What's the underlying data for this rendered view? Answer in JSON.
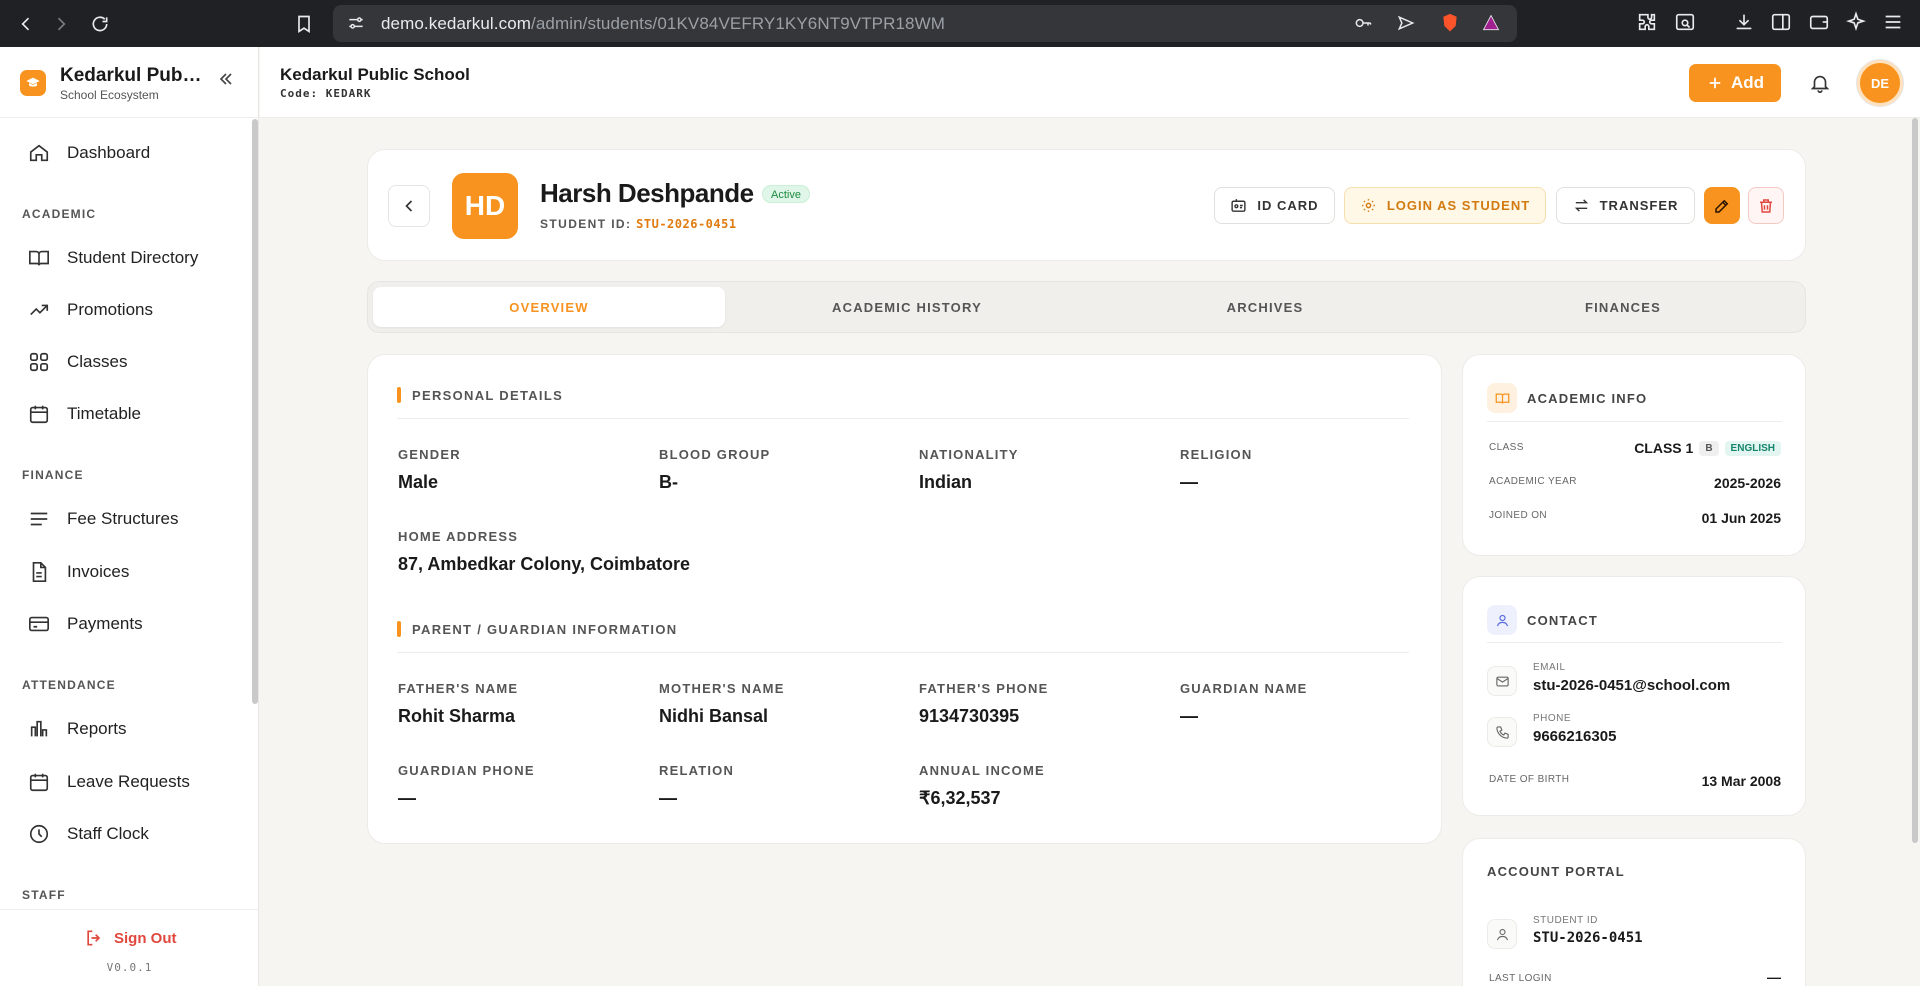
{
  "browser": {
    "url_host": "demo.kedarkul.com",
    "url_path": "/admin/students/01KV84VEFRY1KY6NT9VTPR18WM"
  },
  "sidebar": {
    "brand_name": "Kedarkul Public School",
    "brand_sub": "School Ecosystem",
    "dashboard": "Dashboard",
    "sections": {
      "academic": "ACADEMIC",
      "finance": "FINANCE",
      "attendance": "ATTENDANCE",
      "staff": "STAFF"
    },
    "items": {
      "student_directory": "Student Directory",
      "promotions": "Promotions",
      "classes": "Classes",
      "timetable": "Timetable",
      "fee_structures": "Fee Structures",
      "invoices": "Invoices",
      "payments": "Payments",
      "reports": "Reports",
      "leave_requests": "Leave Requests",
      "staff_clock": "Staff Clock"
    },
    "sign_out": "Sign Out",
    "version": "V0.0.1"
  },
  "header": {
    "school_name": "Kedarkul Public School",
    "code_label": "Code:",
    "code_value": "KEDARK",
    "add_label": "Add",
    "avatar_initials": "DE"
  },
  "profile": {
    "initials": "HD",
    "name": "Harsh Deshpande",
    "status": "Active",
    "student_id_label": "STUDENT ID:",
    "student_id": "STU-2026-0451",
    "actions": {
      "id_card": "ID CARD",
      "login_as_student": "LOGIN AS STUDENT",
      "transfer": "TRANSFER"
    }
  },
  "tabs": [
    "OVERVIEW",
    "ACADEMIC HISTORY",
    "ARCHIVES",
    "FINANCES"
  ],
  "personal": {
    "title": "PERSONAL DETAILS",
    "gender_label": "GENDER",
    "gender": "Male",
    "blood_group_label": "BLOOD GROUP",
    "blood_group": "B-",
    "nationality_label": "NATIONALITY",
    "nationality": "Indian",
    "religion_label": "RELIGION",
    "religion": "—",
    "address_label": "HOME ADDRESS",
    "address": "87, Ambedkar Colony, Coimbatore"
  },
  "guardian": {
    "title": "PARENT / GUARDIAN INFORMATION",
    "father_name_label": "FATHER'S NAME",
    "father_name": "Rohit Sharma",
    "mother_name_label": "MOTHER'S NAME",
    "mother_name": "Nidhi Bansal",
    "father_phone_label": "FATHER'S PHONE",
    "father_phone": "9134730395",
    "guardian_name_label": "GUARDIAN NAME",
    "guardian_name": "—",
    "guardian_phone_label": "GUARDIAN PHONE",
    "guardian_phone": "—",
    "relation_label": "RELATION",
    "relation": "—",
    "income_label": "ANNUAL INCOME",
    "income": "₹6,32,537"
  },
  "academic_info": {
    "title": "ACADEMIC INFO",
    "class_label": "CLASS",
    "class": "CLASS 1",
    "section": "B",
    "medium": "ENGLISH",
    "year_label": "ACADEMIC YEAR",
    "year": "2025-2026",
    "joined_label": "JOINED ON",
    "joined": "01 Jun 2025"
  },
  "contact": {
    "title": "CONTACT",
    "email_label": "EMAIL",
    "email": "stu-2026-0451@school.com",
    "phone_label": "PHONE",
    "phone": "9666216305",
    "dob_label": "DATE OF BIRTH",
    "dob": "13 Mar 2008"
  },
  "account": {
    "title": "ACCOUNT PORTAL",
    "student_id_label": "STUDENT ID",
    "student_id": "STU-2026-0451",
    "last_login_label": "LAST LOGIN",
    "last_login": "—"
  },
  "colors": {
    "accent": "#f7931e",
    "danger": "#e0483e",
    "success": "#1a8a3e"
  }
}
